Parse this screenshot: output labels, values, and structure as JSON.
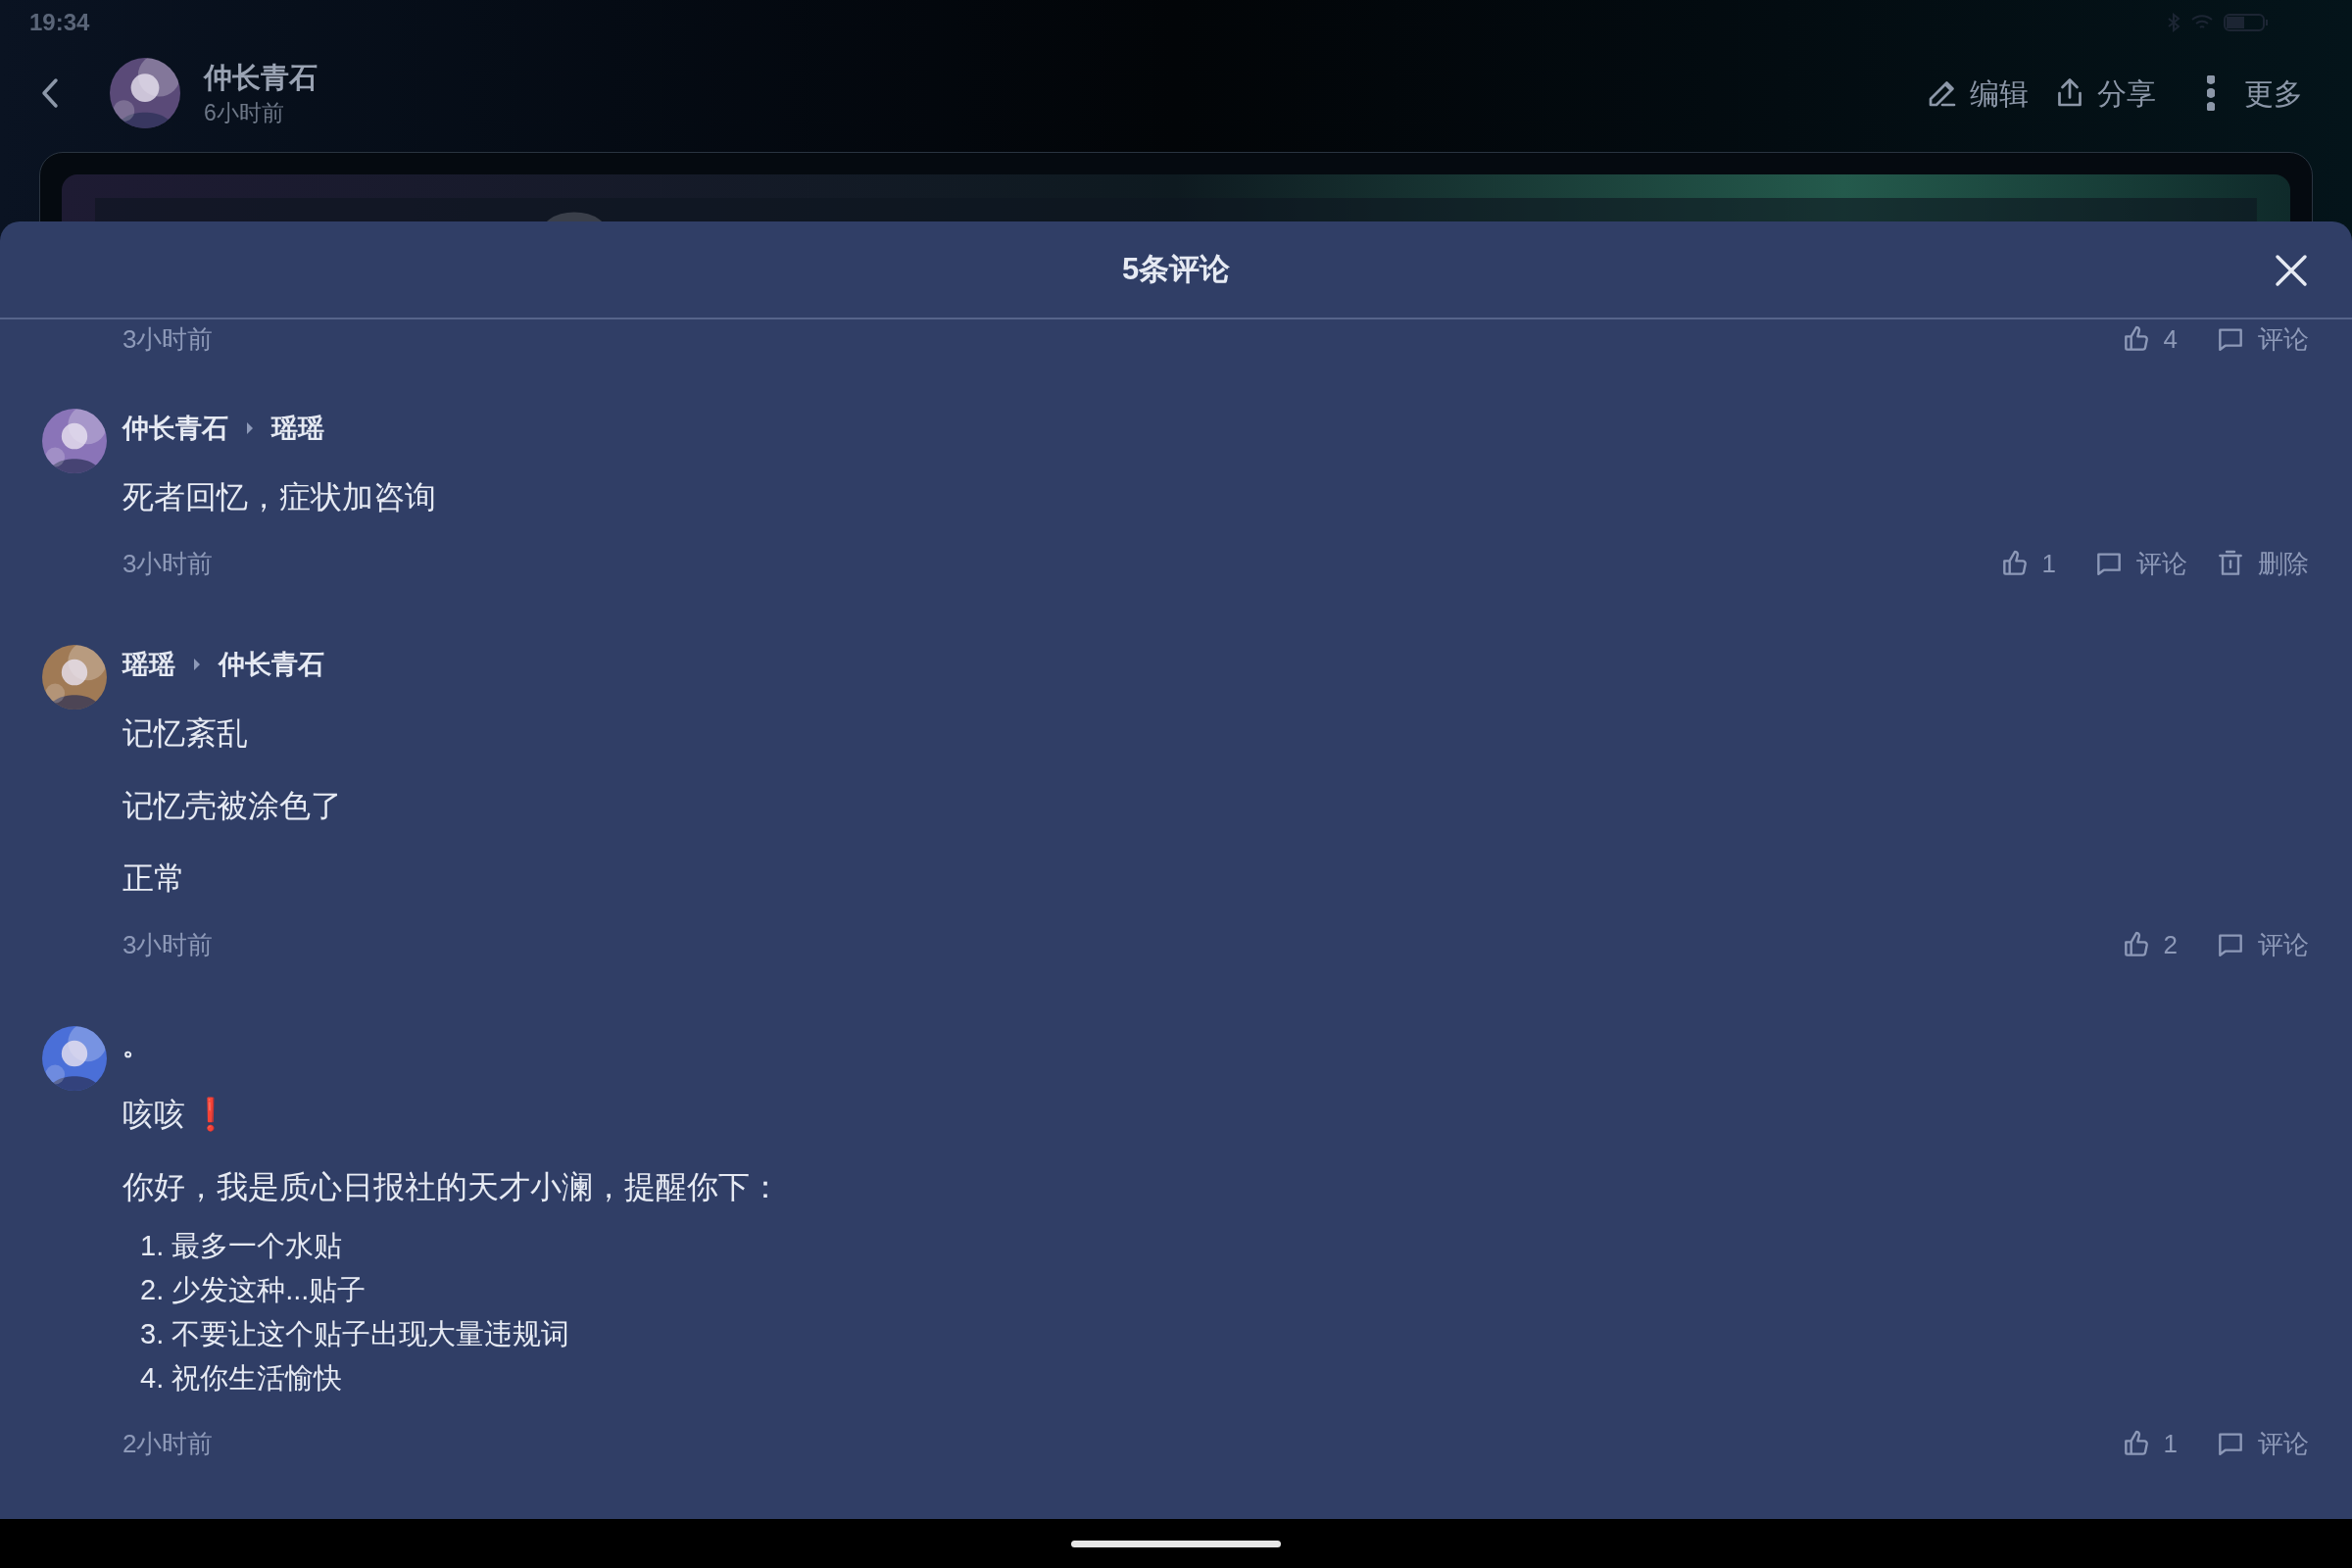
{
  "status_bar": {
    "time": "19:34"
  },
  "post_header": {
    "author": "仲长青石",
    "time": "6小时前",
    "actions": [
      {
        "kind": "edit",
        "label": "编辑"
      },
      {
        "kind": "share",
        "label": "分享"
      },
      {
        "kind": "more",
        "label": "更多"
      }
    ]
  },
  "comments_sheet": {
    "title": "5条评论",
    "partial_comment_footer": {
      "time": "3小时前",
      "actions": [
        {
          "kind": "like",
          "label": "4"
        },
        {
          "kind": "comment",
          "label": "评论"
        }
      ]
    },
    "comments": [
      {
        "author": "仲长青石",
        "reply_to": "瑶瑶",
        "blocks": [
          {
            "kind": "line",
            "text": "死者回忆，症状加咨询"
          }
        ],
        "time": "3小时前",
        "actions": [
          {
            "kind": "like",
            "label": "1"
          },
          {
            "kind": "comment",
            "label": "评论"
          },
          {
            "kind": "delete",
            "label": "删除"
          }
        ]
      },
      {
        "author": "瑶瑶",
        "reply_to": "仲长青石",
        "blocks": [
          {
            "kind": "line",
            "text": "记忆紊乱"
          },
          {
            "kind": "line",
            "text": "记忆壳被涂色了"
          },
          {
            "kind": "line",
            "text": "正常"
          }
        ],
        "time": "3小时前",
        "actions": [
          {
            "kind": "like",
            "label": "2"
          },
          {
            "kind": "comment",
            "label": "评论"
          }
        ]
      },
      {
        "author": "。",
        "blocks": [
          {
            "kind": "line",
            "text": "咳咳",
            "emoji": "❗"
          },
          {
            "kind": "line",
            "text": "你好，我是质心日报社的天才小澜，提醒你下："
          },
          {
            "kind": "list",
            "items": [
              "1. 最多一个水贴",
              "2. 少发这种...贴子",
              "3. 不要让这个贴子出现大量违规词",
              "4. 祝你生活愉快"
            ]
          }
        ],
        "time": "2小时前",
        "actions": [
          {
            "kind": "like",
            "label": "1"
          },
          {
            "kind": "comment",
            "label": "评论"
          }
        ]
      }
    ]
  }
}
